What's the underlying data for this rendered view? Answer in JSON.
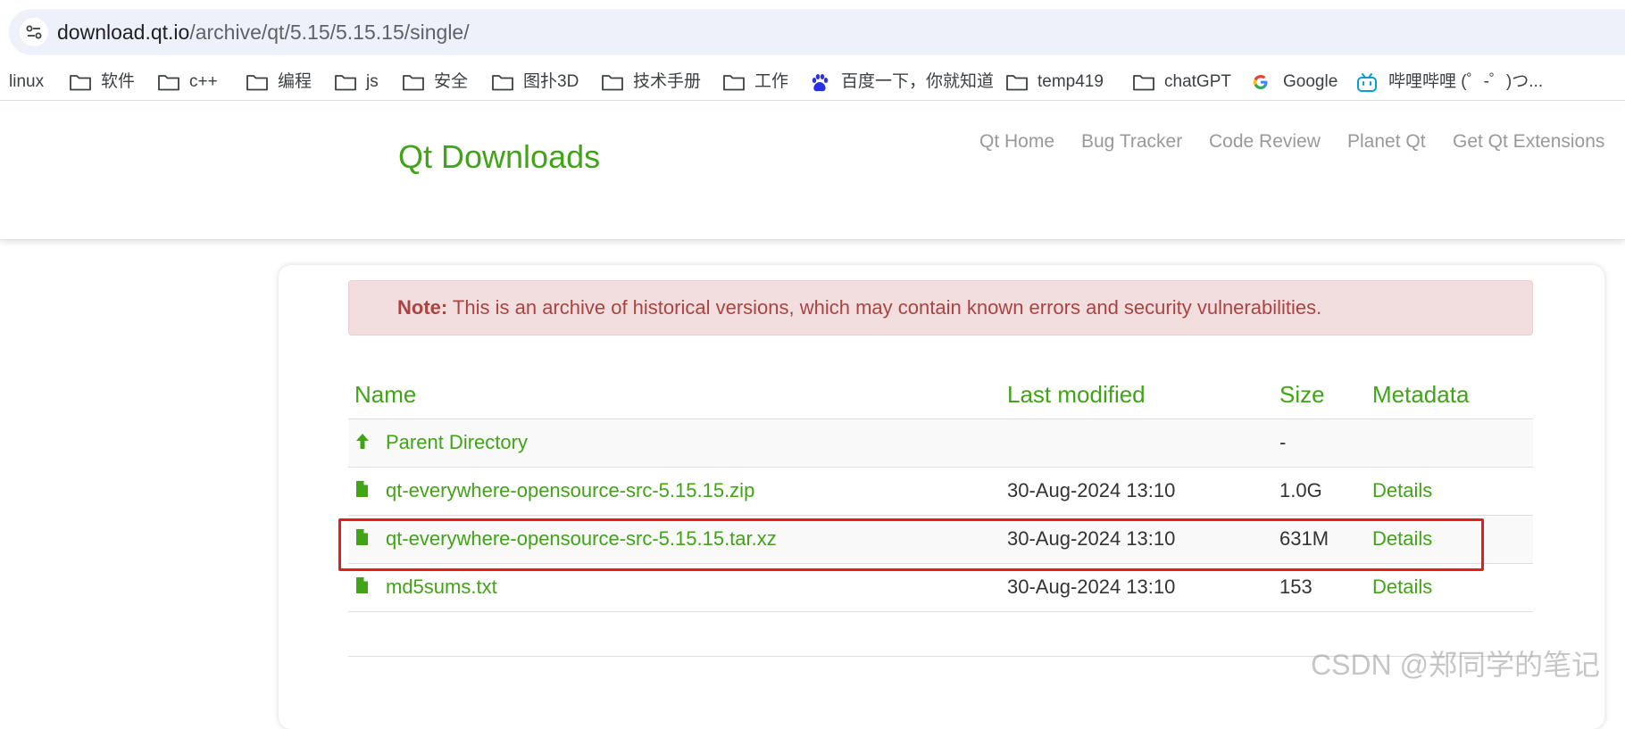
{
  "browser": {
    "url_host": "download.qt.io",
    "url_path": "/archive/qt/5.15/5.15.15/single/",
    "bookmarks": [
      {
        "label": "linux",
        "icon": "none"
      },
      {
        "label": "软件",
        "icon": "folder-icon"
      },
      {
        "label": "c++",
        "icon": "folder-icon"
      },
      {
        "label": "编程",
        "icon": "folder-icon"
      },
      {
        "label": "js",
        "icon": "folder-icon"
      },
      {
        "label": "安全",
        "icon": "folder-icon"
      },
      {
        "label": "图扑3D",
        "icon": "folder-icon"
      },
      {
        "label": "技术手册",
        "icon": "folder-icon"
      },
      {
        "label": "工作",
        "icon": "folder-icon"
      },
      {
        "label": "百度一下，你就知道",
        "icon": "baidu-icon"
      },
      {
        "label": "temp419",
        "icon": "folder-icon"
      },
      {
        "label": "chatGPT",
        "icon": "folder-icon"
      },
      {
        "label": "Google",
        "icon": "google-icon"
      },
      {
        "label": "哔哩哔哩 (゜-゜)つ...",
        "icon": "bilibili-icon"
      }
    ]
  },
  "site": {
    "title": "Qt Downloads",
    "nav": [
      "Qt Home",
      "Bug Tracker",
      "Code Review",
      "Planet Qt",
      "Get Qt Extensions"
    ]
  },
  "note": {
    "label": "Note:",
    "text": " This is an archive of historical versions, which may contain known errors and security vulnerabilities."
  },
  "table": {
    "headers": {
      "name": "Name",
      "modified": "Last modified",
      "size": "Size",
      "metadata": "Metadata"
    },
    "rows": [
      {
        "name": "Parent Directory",
        "modified": "",
        "size": "-",
        "metadata": "",
        "icon": "arrow-up-icon"
      },
      {
        "name": "qt-everywhere-opensource-src-5.15.15.zip",
        "modified": "30-Aug-2024 13:10",
        "size": "1.0G",
        "metadata": "Details",
        "icon": "file-icon"
      },
      {
        "name": "qt-everywhere-opensource-src-5.15.15.tar.xz",
        "modified": "30-Aug-2024 13:10",
        "size": "631M",
        "metadata": "Details",
        "icon": "file-icon",
        "highlighted": true
      },
      {
        "name": "md5sums.txt",
        "modified": "30-Aug-2024 13:10",
        "size": "153",
        "metadata": "Details",
        "icon": "file-icon"
      }
    ]
  },
  "colors": {
    "accent": "#41a317",
    "note_bg": "#f2dede",
    "note_text": "#a94442",
    "highlight": "#e02020"
  },
  "watermark": "CSDN @郑同学的笔记"
}
